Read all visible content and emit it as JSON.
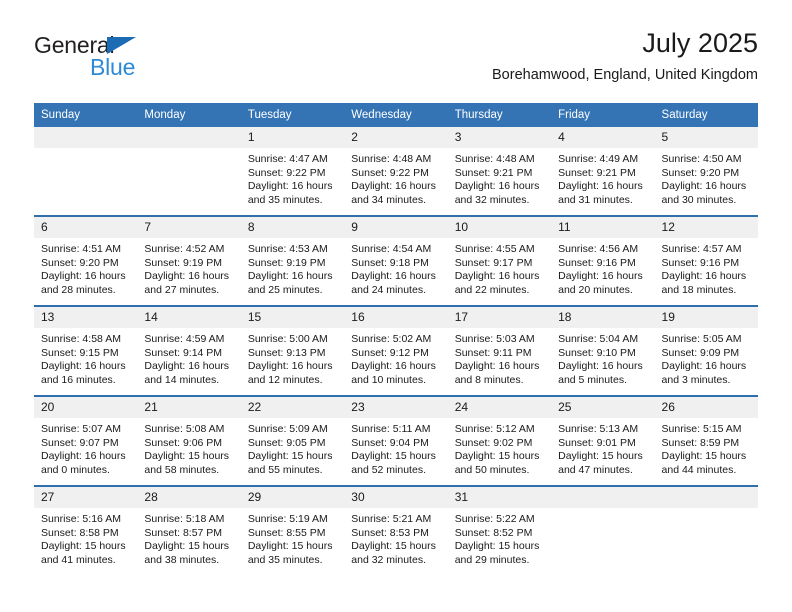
{
  "brand": {
    "name_part1": "General",
    "name_part2": "Blue",
    "triangle_color": "#1b6cb5",
    "blue_color": "#2e8ad6"
  },
  "header": {
    "title": "July 2025",
    "subtitle": "Borehamwood, England, United Kingdom"
  },
  "theme": {
    "header_blue": "#3474b4",
    "separator_blue": "#2f6fad",
    "daynum_band": "#f0f0f0"
  },
  "calendar": {
    "weekday_headers": [
      "Sunday",
      "Monday",
      "Tuesday",
      "Wednesday",
      "Thursday",
      "Friday",
      "Saturday"
    ],
    "weeks": [
      [
        {
          "day": "",
          "empty": true
        },
        {
          "day": "",
          "empty": true
        },
        {
          "day": "1",
          "sunrise": "Sunrise: 4:47 AM",
          "sunset": "Sunset: 9:22 PM",
          "daylight": "Daylight: 16 hours and 35 minutes."
        },
        {
          "day": "2",
          "sunrise": "Sunrise: 4:48 AM",
          "sunset": "Sunset: 9:22 PM",
          "daylight": "Daylight: 16 hours and 34 minutes."
        },
        {
          "day": "3",
          "sunrise": "Sunrise: 4:48 AM",
          "sunset": "Sunset: 9:21 PM",
          "daylight": "Daylight: 16 hours and 32 minutes."
        },
        {
          "day": "4",
          "sunrise": "Sunrise: 4:49 AM",
          "sunset": "Sunset: 9:21 PM",
          "daylight": "Daylight: 16 hours and 31 minutes."
        },
        {
          "day": "5",
          "sunrise": "Sunrise: 4:50 AM",
          "sunset": "Sunset: 9:20 PM",
          "daylight": "Daylight: 16 hours and 30 minutes."
        }
      ],
      [
        {
          "day": "6",
          "sunrise": "Sunrise: 4:51 AM",
          "sunset": "Sunset: 9:20 PM",
          "daylight": "Daylight: 16 hours and 28 minutes."
        },
        {
          "day": "7",
          "sunrise": "Sunrise: 4:52 AM",
          "sunset": "Sunset: 9:19 PM",
          "daylight": "Daylight: 16 hours and 27 minutes."
        },
        {
          "day": "8",
          "sunrise": "Sunrise: 4:53 AM",
          "sunset": "Sunset: 9:19 PM",
          "daylight": "Daylight: 16 hours and 25 minutes."
        },
        {
          "day": "9",
          "sunrise": "Sunrise: 4:54 AM",
          "sunset": "Sunset: 9:18 PM",
          "daylight": "Daylight: 16 hours and 24 minutes."
        },
        {
          "day": "10",
          "sunrise": "Sunrise: 4:55 AM",
          "sunset": "Sunset: 9:17 PM",
          "daylight": "Daylight: 16 hours and 22 minutes."
        },
        {
          "day": "11",
          "sunrise": "Sunrise: 4:56 AM",
          "sunset": "Sunset: 9:16 PM",
          "daylight": "Daylight: 16 hours and 20 minutes."
        },
        {
          "day": "12",
          "sunrise": "Sunrise: 4:57 AM",
          "sunset": "Sunset: 9:16 PM",
          "daylight": "Daylight: 16 hours and 18 minutes."
        }
      ],
      [
        {
          "day": "13",
          "sunrise": "Sunrise: 4:58 AM",
          "sunset": "Sunset: 9:15 PM",
          "daylight": "Daylight: 16 hours and 16 minutes."
        },
        {
          "day": "14",
          "sunrise": "Sunrise: 4:59 AM",
          "sunset": "Sunset: 9:14 PM",
          "daylight": "Daylight: 16 hours and 14 minutes."
        },
        {
          "day": "15",
          "sunrise": "Sunrise: 5:00 AM",
          "sunset": "Sunset: 9:13 PM",
          "daylight": "Daylight: 16 hours and 12 minutes."
        },
        {
          "day": "16",
          "sunrise": "Sunrise: 5:02 AM",
          "sunset": "Sunset: 9:12 PM",
          "daylight": "Daylight: 16 hours and 10 minutes."
        },
        {
          "day": "17",
          "sunrise": "Sunrise: 5:03 AM",
          "sunset": "Sunset: 9:11 PM",
          "daylight": "Daylight: 16 hours and 8 minutes."
        },
        {
          "day": "18",
          "sunrise": "Sunrise: 5:04 AM",
          "sunset": "Sunset: 9:10 PM",
          "daylight": "Daylight: 16 hours and 5 minutes."
        },
        {
          "day": "19",
          "sunrise": "Sunrise: 5:05 AM",
          "sunset": "Sunset: 9:09 PM",
          "daylight": "Daylight: 16 hours and 3 minutes."
        }
      ],
      [
        {
          "day": "20",
          "sunrise": "Sunrise: 5:07 AM",
          "sunset": "Sunset: 9:07 PM",
          "daylight": "Daylight: 16 hours and 0 minutes."
        },
        {
          "day": "21",
          "sunrise": "Sunrise: 5:08 AM",
          "sunset": "Sunset: 9:06 PM",
          "daylight": "Daylight: 15 hours and 58 minutes."
        },
        {
          "day": "22",
          "sunrise": "Sunrise: 5:09 AM",
          "sunset": "Sunset: 9:05 PM",
          "daylight": "Daylight: 15 hours and 55 minutes."
        },
        {
          "day": "23",
          "sunrise": "Sunrise: 5:11 AM",
          "sunset": "Sunset: 9:04 PM",
          "daylight": "Daylight: 15 hours and 52 minutes."
        },
        {
          "day": "24",
          "sunrise": "Sunrise: 5:12 AM",
          "sunset": "Sunset: 9:02 PM",
          "daylight": "Daylight: 15 hours and 50 minutes."
        },
        {
          "day": "25",
          "sunrise": "Sunrise: 5:13 AM",
          "sunset": "Sunset: 9:01 PM",
          "daylight": "Daylight: 15 hours and 47 minutes."
        },
        {
          "day": "26",
          "sunrise": "Sunrise: 5:15 AM",
          "sunset": "Sunset: 8:59 PM",
          "daylight": "Daylight: 15 hours and 44 minutes."
        }
      ],
      [
        {
          "day": "27",
          "sunrise": "Sunrise: 5:16 AM",
          "sunset": "Sunset: 8:58 PM",
          "daylight": "Daylight: 15 hours and 41 minutes."
        },
        {
          "day": "28",
          "sunrise": "Sunrise: 5:18 AM",
          "sunset": "Sunset: 8:57 PM",
          "daylight": "Daylight: 15 hours and 38 minutes."
        },
        {
          "day": "29",
          "sunrise": "Sunrise: 5:19 AM",
          "sunset": "Sunset: 8:55 PM",
          "daylight": "Daylight: 15 hours and 35 minutes."
        },
        {
          "day": "30",
          "sunrise": "Sunrise: 5:21 AM",
          "sunset": "Sunset: 8:53 PM",
          "daylight": "Daylight: 15 hours and 32 minutes."
        },
        {
          "day": "31",
          "sunrise": "Sunrise: 5:22 AM",
          "sunset": "Sunset: 8:52 PM",
          "daylight": "Daylight: 15 hours and 29 minutes."
        },
        {
          "day": "",
          "empty": true
        },
        {
          "day": "",
          "empty": true
        }
      ]
    ]
  }
}
